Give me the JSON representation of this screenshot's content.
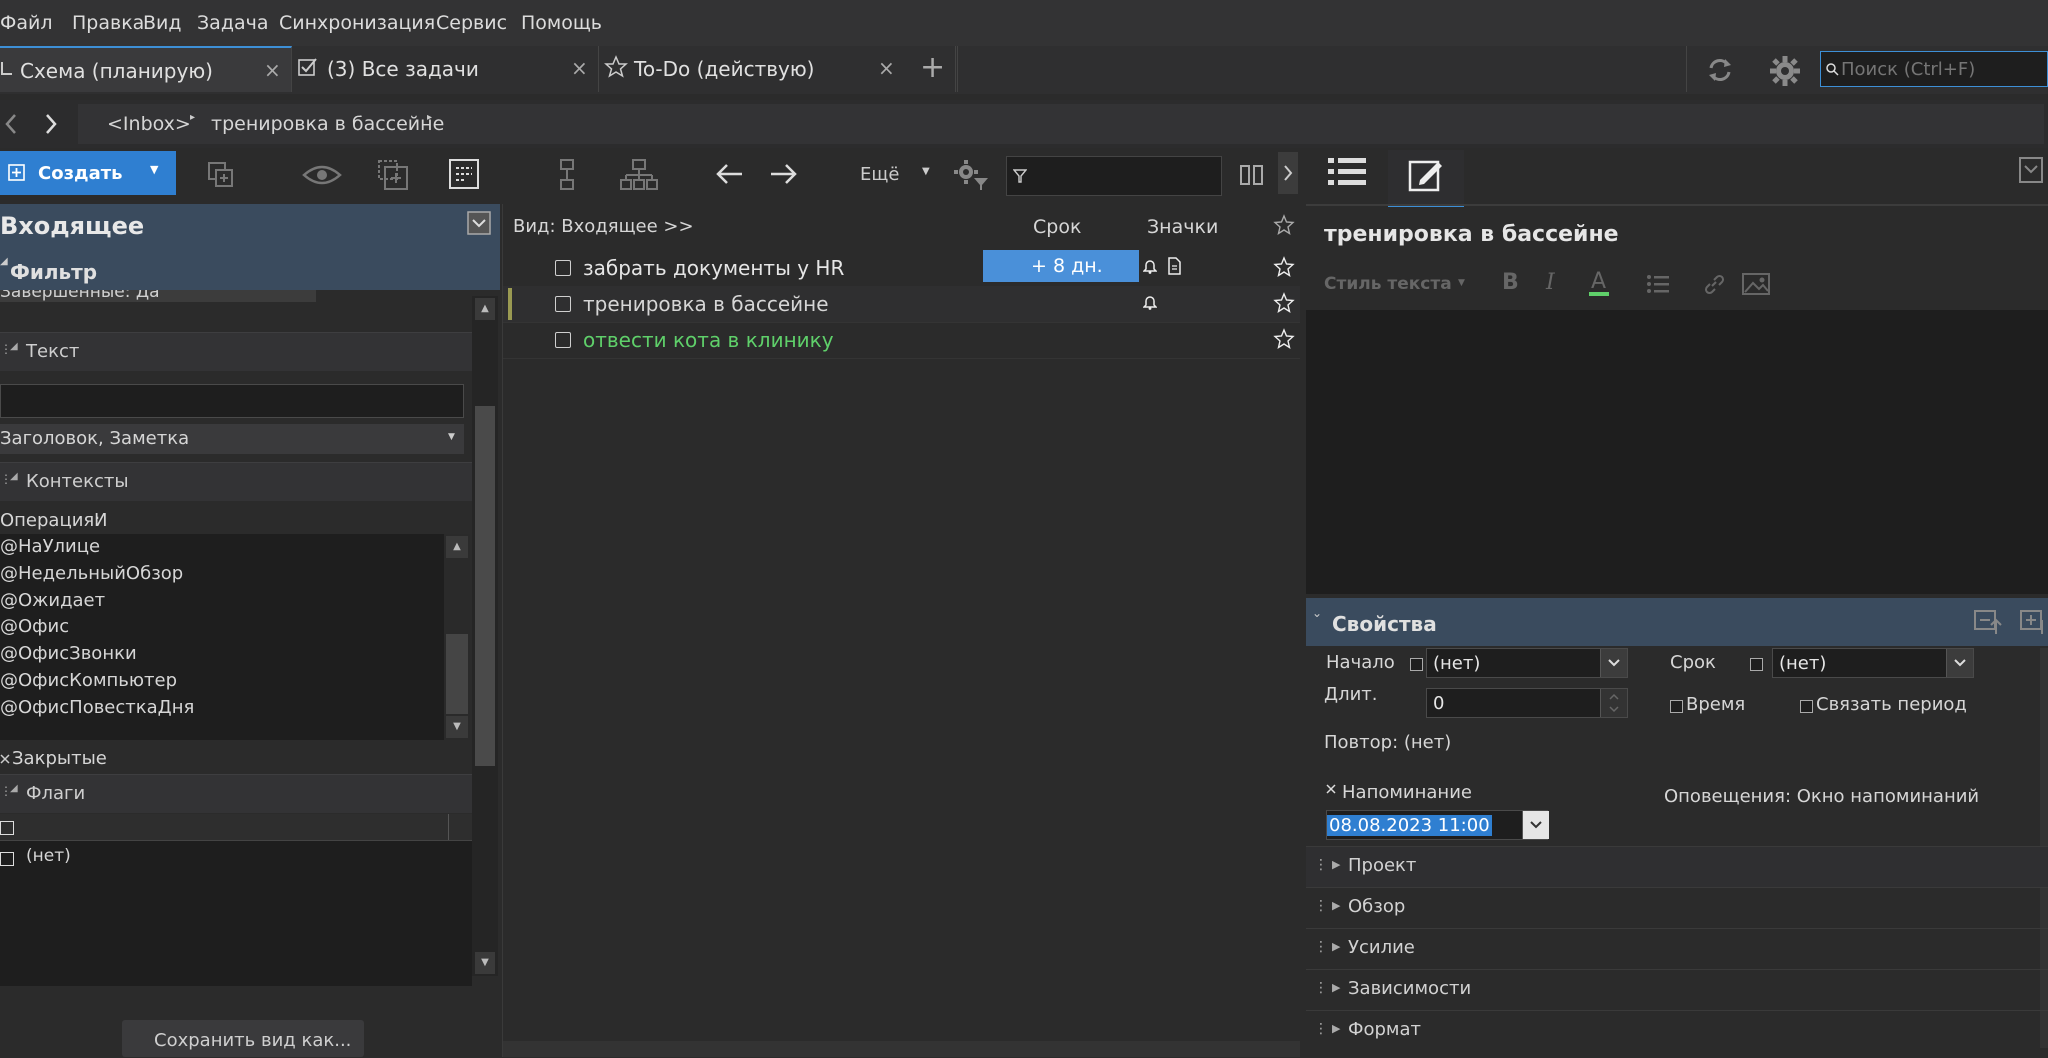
{
  "menu": [
    "Файл",
    "Правка",
    "Вид",
    "Задача",
    "Синхронизация",
    "Сервис",
    "Помощь"
  ],
  "tabs": [
    {
      "label": "Схема (планирую)"
    },
    {
      "label": "(3) Все задачи"
    },
    {
      "label": "To-Do (действую)"
    }
  ],
  "tab_close": "×",
  "tab_add": "+",
  "search": {
    "placeholder": "Поиск (Ctrl+F)"
  },
  "breadcrumb": [
    "<Inbox>",
    "тренировка в бассейне"
  ],
  "toolbar": {
    "create_label": "Создать",
    "more_label": "Ещё"
  },
  "left": {
    "title": "Входящее",
    "filter_label": "Фильтр",
    "completed_label": "Завершенные: Да",
    "text_section": "Текст",
    "text_fields": "Заголовок, Заметка",
    "contexts_section": "Контексты",
    "operation_label": "Операция:",
    "operation_value": "И",
    "contexts": [
      "@НаУлице",
      "@НедельныйОбзор",
      "@Ожидает",
      "@Офис",
      "@ОфисЗвонки",
      "@ОфисКомпьютер",
      "@ОфисПовесткаДня"
    ],
    "closed_label": "Закрытые",
    "flags_section": "Флаги",
    "flag_none": "(нет)",
    "save_view": "Сохранить вид как..."
  },
  "center": {
    "view_label": "Вид: Входящее >>",
    "col_due": "Срок",
    "col_icons": "Значки",
    "tasks": [
      {
        "title": "забрать документы у HR",
        "due": "+ 8 дн.",
        "color": "#e6e6e6"
      },
      {
        "title": "тренировка в бассейне",
        "due": "",
        "color": "#d6d6d6"
      },
      {
        "title": "отвести кота в клинику",
        "due": "",
        "color": "#5fd06a"
      }
    ]
  },
  "right": {
    "task_title": "тренировка в бассейне",
    "text_style": "Стиль текста",
    "props_title": "Свойства",
    "start_label": "Начало",
    "start_value": "(нет)",
    "due_label": "Срок",
    "due_value": "(нет)",
    "duration_label": "Длит.",
    "duration_value": "0",
    "time_label": "Время",
    "link_period_label": "Связать период",
    "repeat_label": "Повтор: (нет)",
    "reminder_label": "Напоминание",
    "reminder_value": "08.08.2023 11:00",
    "alerts_label": "Оповещения: Окно напоминаний",
    "sections": [
      "Проект",
      "Обзор",
      "Усилие",
      "Зависимости",
      "Формат"
    ]
  },
  "colors": {
    "accent": "#2f7fd1",
    "due_badge": "#4a90d9",
    "green_task": "#5fd06a"
  }
}
